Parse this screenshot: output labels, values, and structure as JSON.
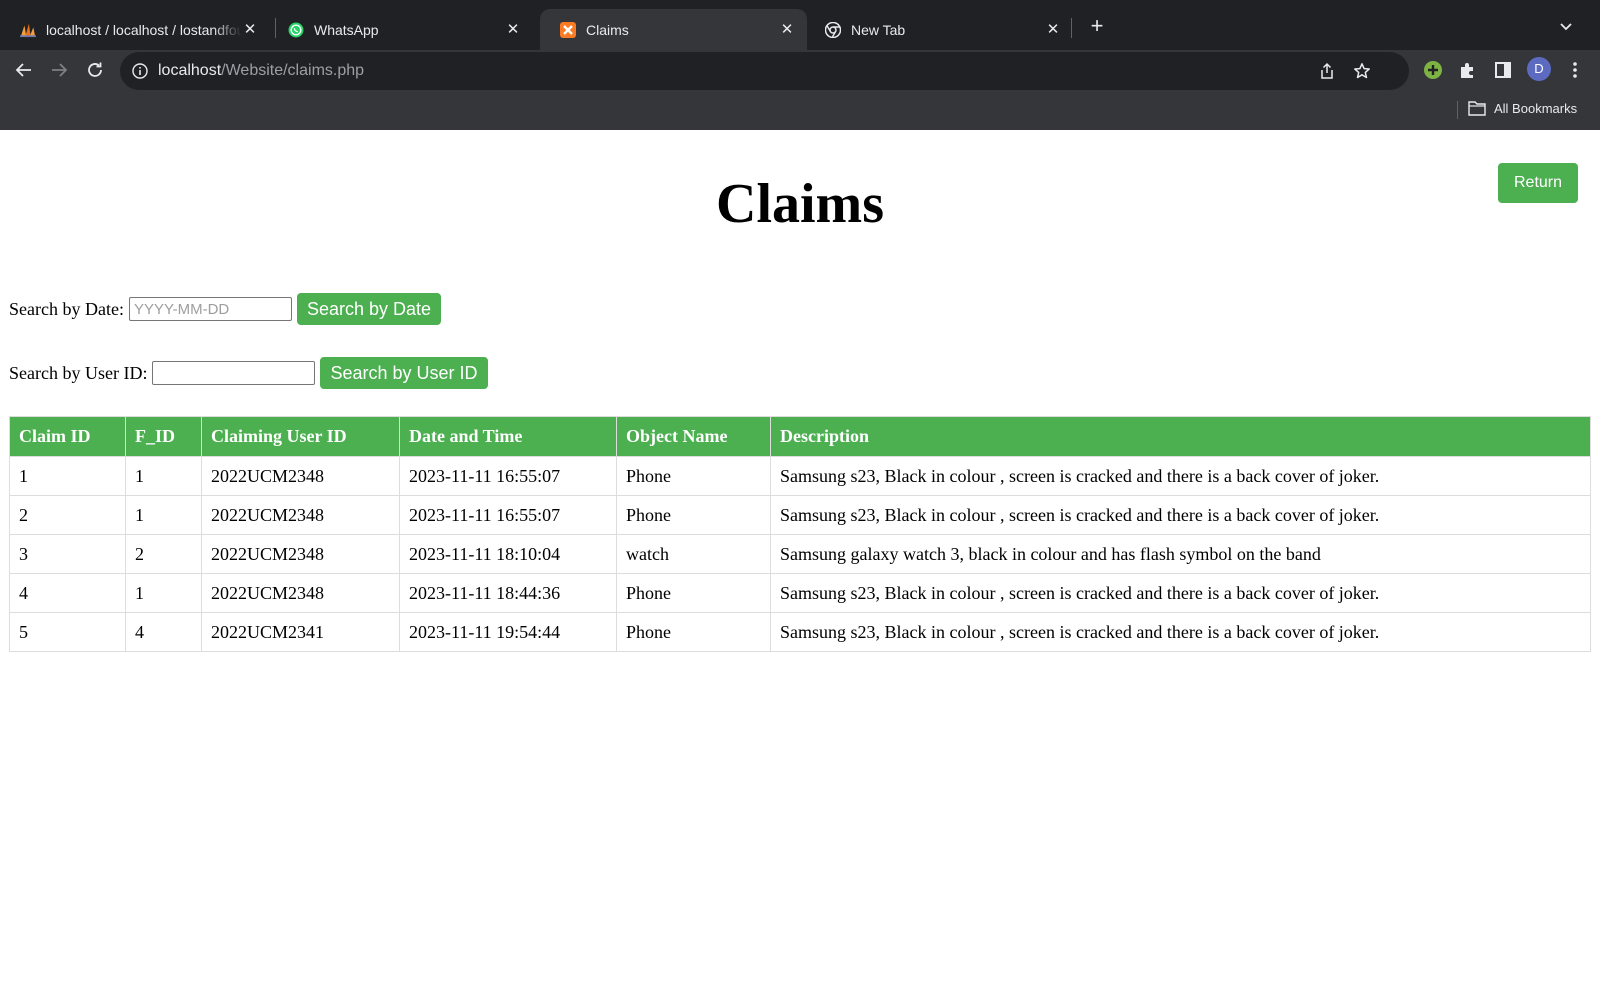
{
  "browser": {
    "tabs": [
      {
        "title": "localhost / localhost / lostandfound",
        "icon": "phpmyadmin-icon",
        "active": false
      },
      {
        "title": "WhatsApp",
        "icon": "whatsapp-icon",
        "active": false
      },
      {
        "title": "Claims",
        "icon": "xampp-icon",
        "active": true
      },
      {
        "title": "New Tab",
        "icon": "chrome-icon",
        "active": false
      }
    ],
    "url_host": "localhost",
    "url_path": "/Website/claims.php",
    "profile_initial": "D",
    "bookmarks_label": "All Bookmarks"
  },
  "page": {
    "title": "Claims",
    "return_label": "Return",
    "search_date": {
      "label": "Search by Date:",
      "placeholder": "YYYY-MM-DD",
      "value": "",
      "button": "Search by Date"
    },
    "search_user": {
      "label": "Search by User ID:",
      "placeholder": "",
      "value": "",
      "button": "Search by User ID"
    },
    "table": {
      "headers": [
        "Claim ID",
        "F_ID",
        "Claiming User ID",
        "Date and Time",
        "Object Name",
        "Description"
      ],
      "rows": [
        [
          "1",
          "1",
          "2022UCM2348",
          "2023-11-11 16:55:07",
          "Phone",
          "Samsung s23, Black in colour , screen is cracked and there is a back cover of joker."
        ],
        [
          "2",
          "1",
          "2022UCM2348",
          "2023-11-11 16:55:07",
          "Phone",
          "Samsung s23, Black in colour , screen is cracked and there is a back cover of joker."
        ],
        [
          "3",
          "2",
          "2022UCM2348",
          "2023-11-11 18:10:04",
          "watch",
          "Samsung galaxy watch 3, black in colour and has flash symbol on the band"
        ],
        [
          "4",
          "1",
          "2022UCM2348",
          "2023-11-11 18:44:36",
          "Phone",
          "Samsung s23, Black in colour , screen is cracked and there is a back cover of joker."
        ],
        [
          "5",
          "4",
          "2022UCM2341",
          "2023-11-11 19:54:44",
          "Phone",
          "Samsung s23, Black in colour , screen is cracked and there is a back cover of joker."
        ]
      ]
    }
  },
  "colors": {
    "accent_green": "#4caf50",
    "chrome_dark": "#202124",
    "chrome_toolbar": "#35363a"
  }
}
